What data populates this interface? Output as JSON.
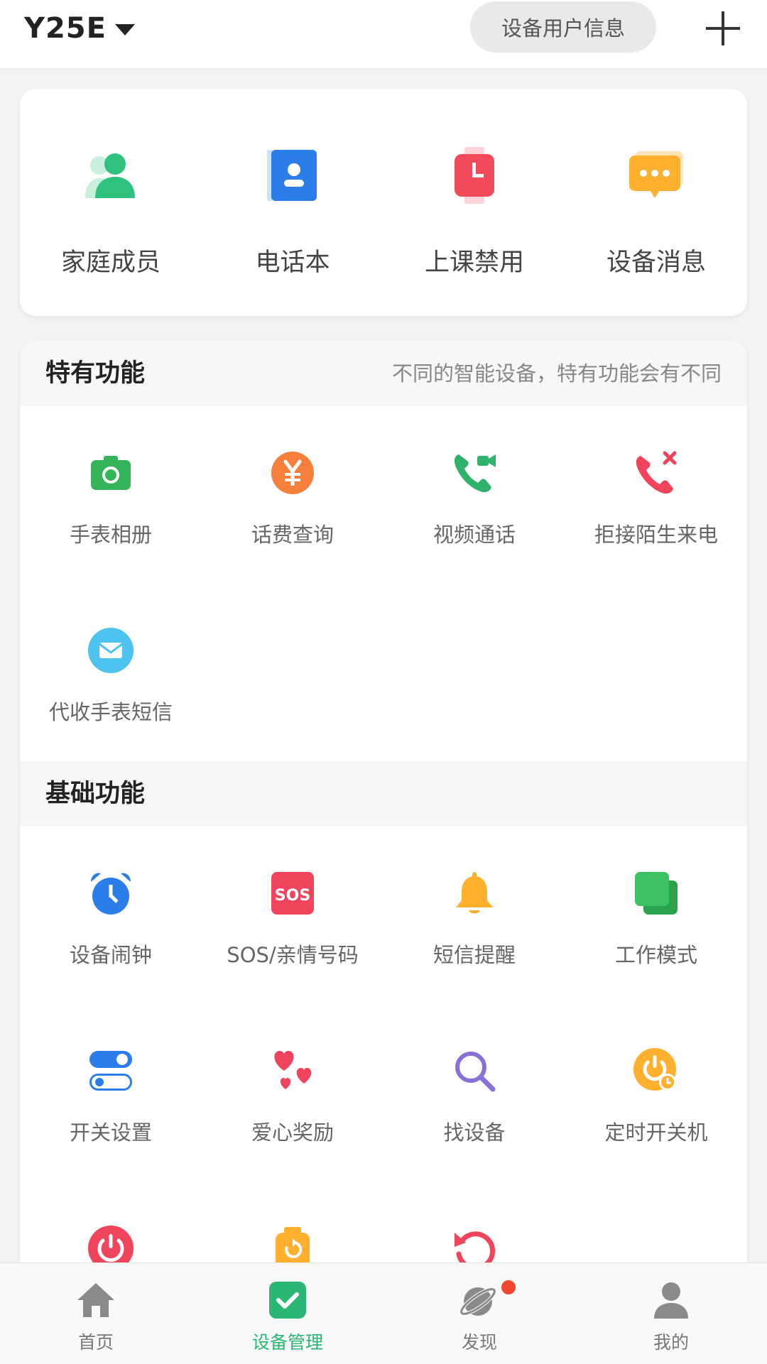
{
  "header": {
    "device_name": "Y25E",
    "user_info_label": "设备用户信息"
  },
  "quick_actions": [
    {
      "label": "家庭成员",
      "icon": "family-members-icon",
      "color": "#2ec27e"
    },
    {
      "label": "电话本",
      "icon": "phonebook-icon",
      "color": "#2b7de9"
    },
    {
      "label": "上课禁用",
      "icon": "class-disable-watch-icon",
      "color": "#f04a5b"
    },
    {
      "label": "设备消息",
      "icon": "device-message-icon",
      "color": "#ffb02e"
    }
  ],
  "special_section": {
    "title": "特有功能",
    "description": "不同的智能设备，特有功能会有不同",
    "items": [
      {
        "label": "手表相册",
        "icon": "camera-icon",
        "color": "#34b55a"
      },
      {
        "label": "话费查询",
        "icon": "yuan-coin-icon",
        "color": "#f57f3b"
      },
      {
        "label": "视频通话",
        "icon": "video-call-icon",
        "color": "#2fb36a"
      },
      {
        "label": "拒接陌生来电",
        "icon": "reject-call-icon",
        "color": "#f0445c"
      },
      {
        "label": "代收手表短信",
        "icon": "mail-icon",
        "color": "#4fc3ef"
      }
    ]
  },
  "basic_section": {
    "title": "基础功能",
    "items": [
      {
        "label": "设备闹钟",
        "icon": "alarm-clock-icon",
        "color": "#2b7de9"
      },
      {
        "label": "SOS/亲情号码",
        "icon": "sos-icon",
        "color": "#f0445c"
      },
      {
        "label": "短信提醒",
        "icon": "bell-icon",
        "color": "#ffb02e"
      },
      {
        "label": "工作模式",
        "icon": "work-mode-icon",
        "color": "#34b55a"
      },
      {
        "label": "开关设置",
        "icon": "toggle-switch-icon",
        "color": "#2b7de9"
      },
      {
        "label": "爱心奖励",
        "icon": "hearts-icon",
        "color": "#f0445c"
      },
      {
        "label": "找设备",
        "icon": "search-icon",
        "color": "#8a6fd8"
      },
      {
        "label": "定时开关机",
        "icon": "timed-power-icon",
        "color": "#ffb02e"
      },
      {
        "label": "",
        "icon": "power-icon",
        "color": "#f0445c"
      },
      {
        "label": "",
        "icon": "watch-reset-icon",
        "color": "#ffb02e"
      },
      {
        "label": "",
        "icon": "restore-icon",
        "color": "#f0445c"
      }
    ]
  },
  "bottom_nav": [
    {
      "label": "首页",
      "icon": "home-icon",
      "active": false
    },
    {
      "label": "设备管理",
      "icon": "device-manage-icon",
      "active": true
    },
    {
      "label": "发现",
      "icon": "discover-planet-icon",
      "active": false,
      "badge": true
    },
    {
      "label": "我的",
      "icon": "profile-icon",
      "active": false
    }
  ]
}
